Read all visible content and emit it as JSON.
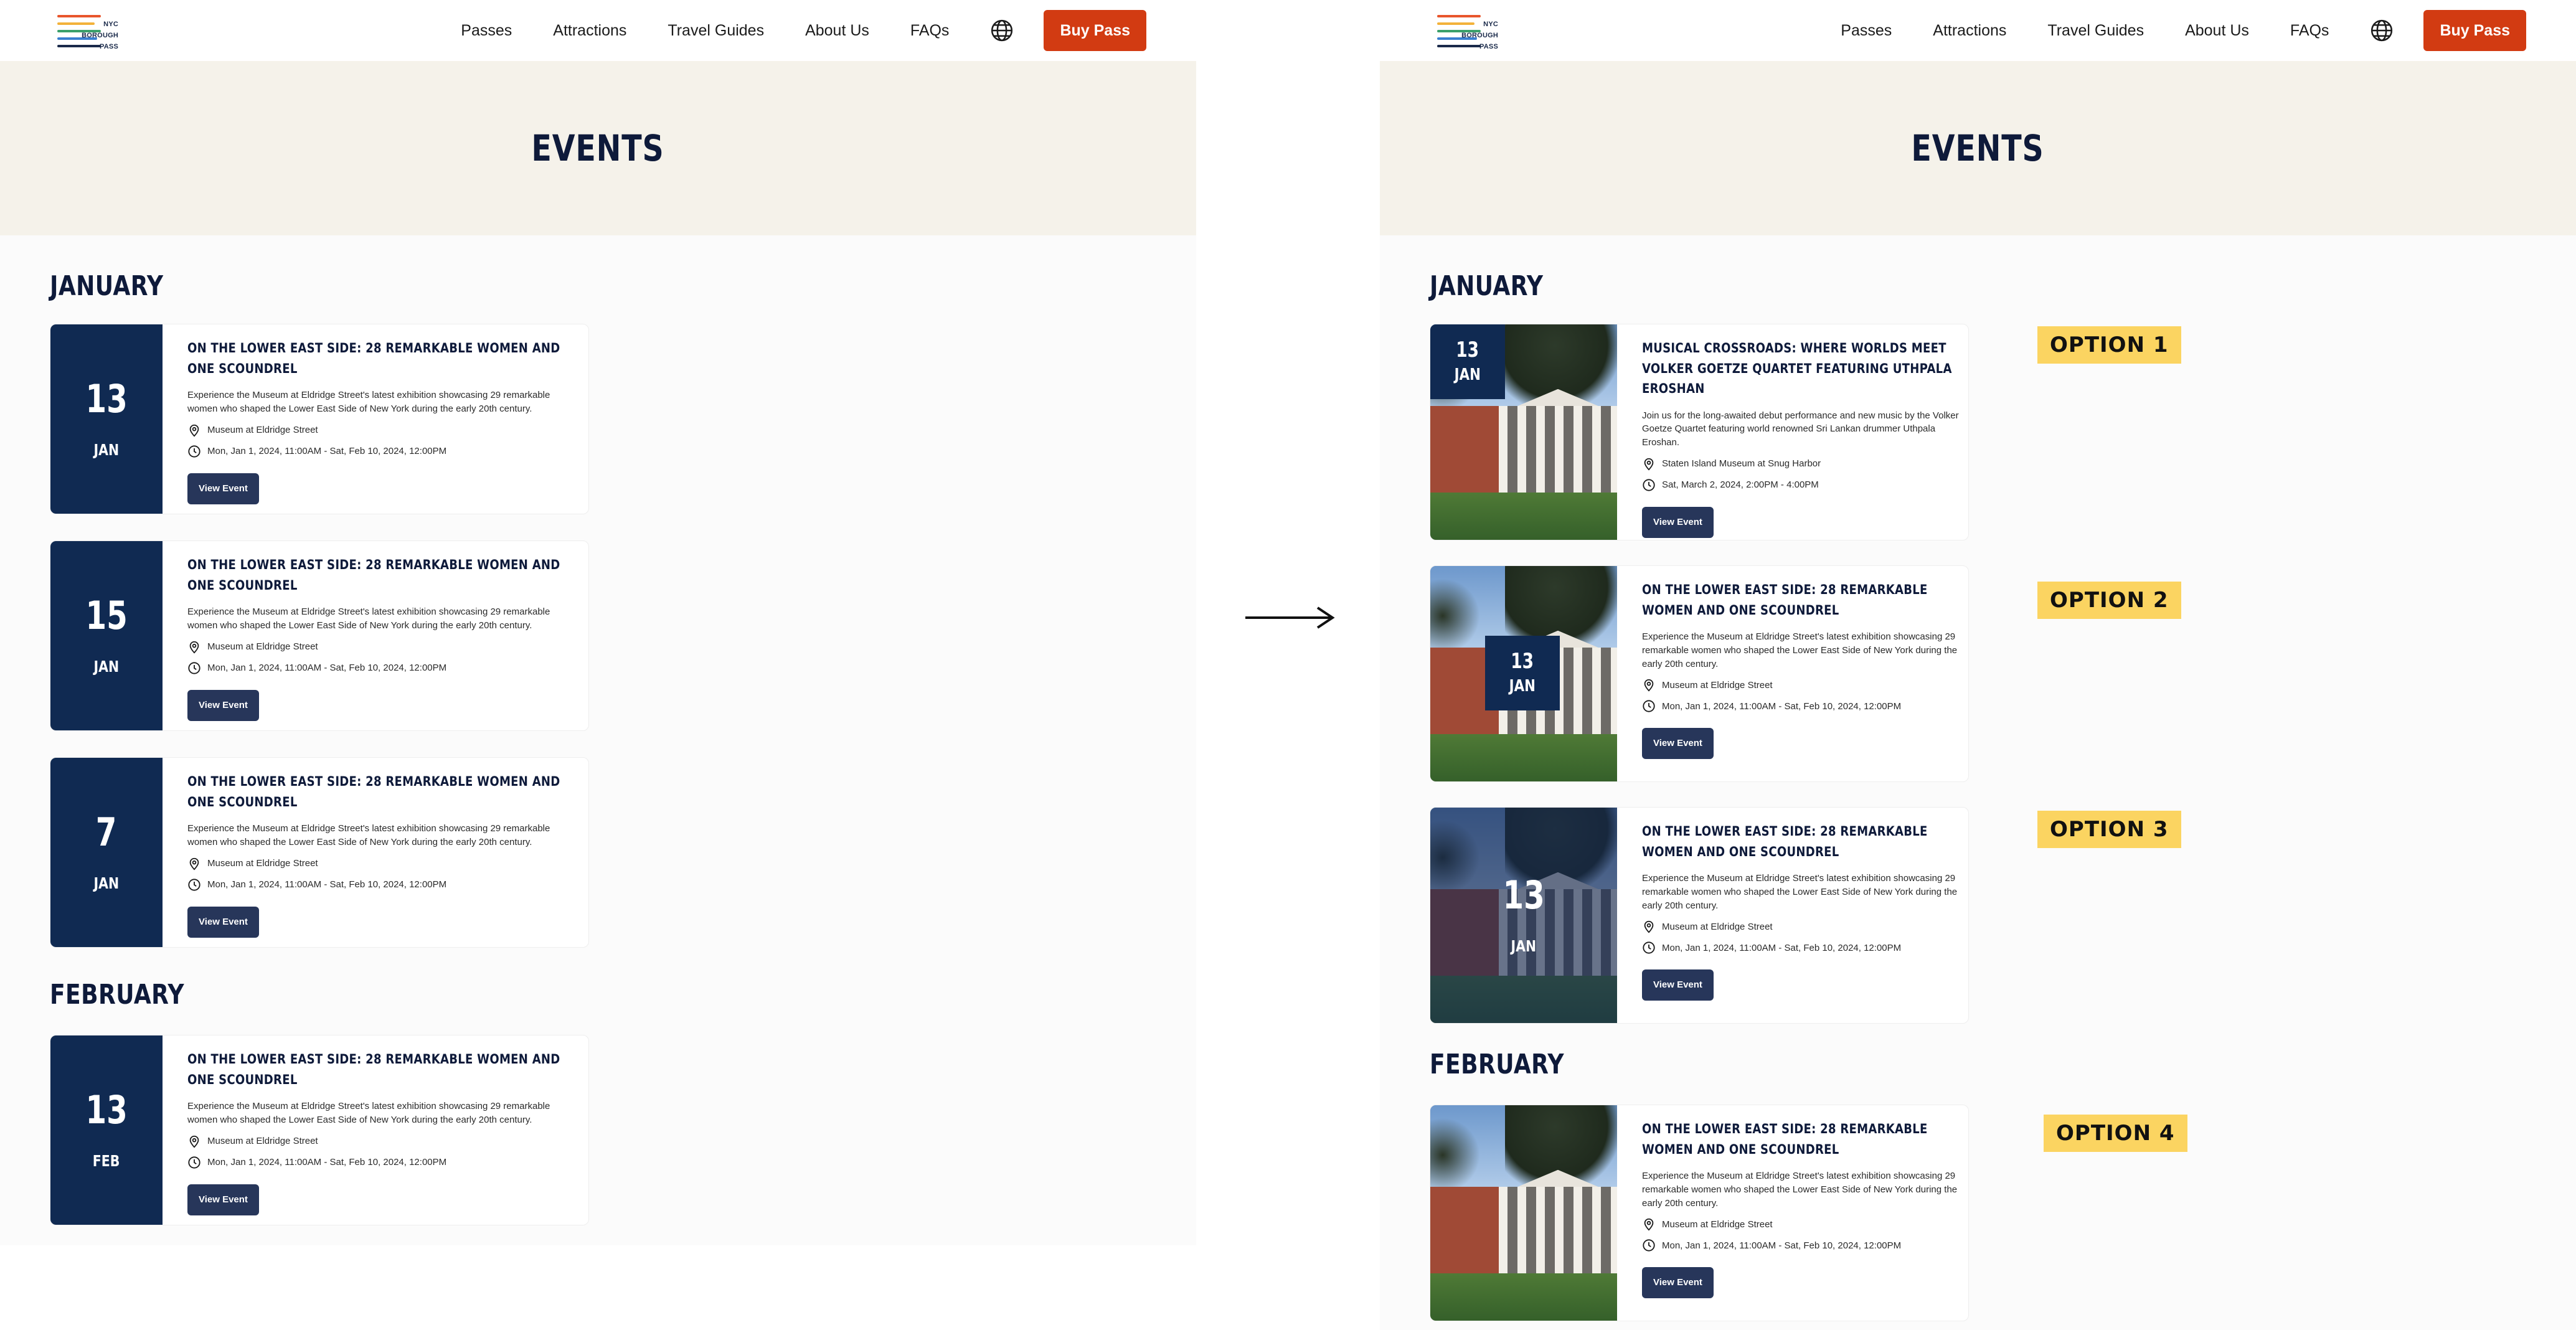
{
  "header": {
    "logo_lines": [
      "NYC",
      "BOROUGH",
      "PASS"
    ],
    "nav": [
      "Passes",
      "Attractions",
      "Travel Guides",
      "About Us",
      "FAQs"
    ],
    "buy_label": "Buy Pass"
  },
  "hero_title": "EVENTS",
  "before": {
    "months": [
      {
        "name": "JANUARY",
        "events": [
          {
            "day": "13",
            "mon": "JAN",
            "title": "ON THE LOWER EAST SIDE: 28 REMARKABLE WOMEN AND ONE SCOUNDREL",
            "desc": "Experience the Museum at Eldridge Street's latest exhibition showcasing 29 remarkable women who shaped the Lower East Side of New York during the early 20th century.",
            "location": "Museum at Eldridge Street",
            "time": "Mon, Jan 1, 2024, 11:00AM - Sat, Feb 10, 2024, 12:00PM",
            "button": "View Event"
          },
          {
            "day": "15",
            "mon": "JAN",
            "title": "ON THE LOWER EAST SIDE: 28 REMARKABLE WOMEN AND ONE SCOUNDREL",
            "desc": "Experience the Museum at Eldridge Street's latest exhibition showcasing 29 remarkable women who shaped the Lower East Side of New York during the early 20th century.",
            "location": "Museum at Eldridge Street",
            "time": "Mon, Jan 1, 2024, 11:00AM - Sat, Feb 10, 2024, 12:00PM",
            "button": "View Event"
          },
          {
            "day": "7",
            "mon": "JAN",
            "title": "ON THE LOWER EAST SIDE: 28 REMARKABLE WOMEN AND ONE SCOUNDREL",
            "desc": "Experience the Museum at Eldridge Street's latest exhibition showcasing 29 remarkable women who shaped the Lower East Side of New York during the early 20th century.",
            "location": "Museum at Eldridge Street",
            "time": "Mon, Jan 1, 2024, 11:00AM - Sat, Feb 10, 2024, 12:00PM",
            "button": "View Event"
          }
        ]
      },
      {
        "name": "FEBRUARY",
        "events": [
          {
            "day": "13",
            "mon": "FEB",
            "title": "ON THE LOWER EAST SIDE: 28 REMARKABLE WOMEN AND ONE SCOUNDREL",
            "desc": "Experience the Museum at Eldridge Street's latest exhibition showcasing 29 remarkable women who shaped the Lower East Side of New York during the early 20th century.",
            "location": "Museum at Eldridge Street",
            "time": "Mon, Jan 1, 2024, 11:00AM - Sat, Feb 10, 2024, 12:00PM",
            "button": "View Event"
          }
        ]
      }
    ]
  },
  "after": {
    "months": [
      {
        "name": "JANUARY",
        "events": [
          {
            "option": "OPTION 1",
            "day": "13",
            "mon": "JAN",
            "title": "MUSICAL CROSSROADS: WHERE WORLDS MEET VOLKER GOETZE QUARTET FEATURING UTHPALA EROSHAN",
            "desc": "Join us for the long-awaited debut performance and new music by the Volker Goetze Quartet featuring world renowned Sri Lankan drummer Uthpala Eroshan.",
            "location": "Staten Island Museum at Snug Harbor",
            "time": "Sat, March 2, 2024, 2:00PM - 4:00PM",
            "button": "View Event"
          },
          {
            "option": "OPTION 2",
            "day": "13",
            "mon": "JAN",
            "title": "ON THE LOWER EAST SIDE: 28 REMARKABLE WOMEN AND ONE SCOUNDREL",
            "desc": "Experience the Museum at Eldridge Street's latest exhibition showcasing 29 remarkable women who shaped the Lower East Side of New York during the early 20th century.",
            "location": "Museum at Eldridge Street",
            "time": "Mon, Jan 1, 2024, 11:00AM - Sat, Feb 10, 2024, 12:00PM",
            "button": "View Event"
          },
          {
            "option": "OPTION 3",
            "day": "13",
            "mon": "JAN",
            "title": "ON THE LOWER EAST SIDE: 28 REMARKABLE WOMEN AND ONE SCOUNDREL",
            "desc": "Experience the Museum at Eldridge Street's latest exhibition showcasing 29 remarkable women who shaped the Lower East Side of New York during the early 20th century.",
            "location": "Museum at Eldridge Street",
            "time": "Mon, Jan 1, 2024, 11:00AM - Sat, Feb 10, 2024, 12:00PM",
            "button": "View Event"
          }
        ]
      },
      {
        "name": "FEBRUARY",
        "events": [
          {
            "option": "OPTION 4",
            "title": "ON THE LOWER EAST SIDE: 28 REMARKABLE WOMEN AND ONE SCOUNDREL",
            "desc": "Experience the Museum at Eldridge Street's latest exhibition showcasing 29 remarkable women who shaped the Lower East Side of New York during the early 20th century.",
            "location": "Museum at Eldridge Street",
            "time": "Mon, Jan 1, 2024, 11:00AM - Sat, Feb 10, 2024, 12:00PM",
            "button": "View Event"
          }
        ]
      }
    ]
  },
  "colors": {
    "navy": "#102a52",
    "button": "#27365a",
    "buy": "#d23b12",
    "hero_bg": "#f5f2ea",
    "option_tag": "#fbd461"
  },
  "icons": [
    "globe-icon",
    "location-pin-icon",
    "clock-icon",
    "arrow-right-icon"
  ]
}
